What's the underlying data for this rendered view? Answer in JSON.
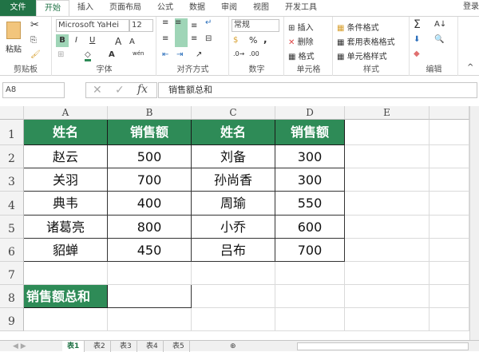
{
  "tabs": [
    "文件",
    "开始",
    "插入",
    "页面布局",
    "公式",
    "数据",
    "审阅",
    "视图",
    "开发工具"
  ],
  "login": "登录",
  "ribbon": {
    "clipboard": {
      "paste": "粘贴",
      "label": "剪贴板"
    },
    "font": {
      "name": "Microsoft YaHei",
      "size": "12",
      "bold": "B",
      "italic": "I",
      "underline": "U",
      "grow": "A",
      "shrink": "A",
      "color": "A",
      "phonetic": "wén",
      "label": "字体"
    },
    "alignment": {
      "label": "对齐方式"
    },
    "number": {
      "format": "常规",
      "percent": "%",
      "comma": ",",
      "label": "数字"
    },
    "cells": {
      "insert": "插入",
      "delete": "删除",
      "format": "格式",
      "label": "单元格"
    },
    "styles": {
      "conditional": "条件格式",
      "table": "套用表格格式",
      "cell": "单元格样式",
      "label": "样式"
    },
    "editing": {
      "sum": "Σ",
      "label": "编辑"
    }
  },
  "formula_bar": {
    "name_box": "A8",
    "fx": "fx",
    "content": "销售额总和"
  },
  "columns": [
    "A",
    "B",
    "C",
    "D",
    "E"
  ],
  "rows": [
    "1",
    "2",
    "3",
    "4",
    "5",
    "6",
    "7",
    "8",
    "9"
  ],
  "table": {
    "headers": [
      "姓名",
      "销售额",
      "姓名",
      "销售额"
    ],
    "rows": [
      [
        "赵云",
        "500",
        "刘备",
        "300"
      ],
      [
        "关羽",
        "700",
        "孙尚香",
        "300"
      ],
      [
        "典韦",
        "400",
        "周瑜",
        "550"
      ],
      [
        "诸葛亮",
        "800",
        "小乔",
        "600"
      ],
      [
        "貂蝉",
        "450",
        "吕布",
        "700"
      ]
    ]
  },
  "a8": "销售额总和",
  "sheets": [
    "表1",
    "表2",
    "表3",
    "表4",
    "表5"
  ],
  "accent": "#217346"
}
